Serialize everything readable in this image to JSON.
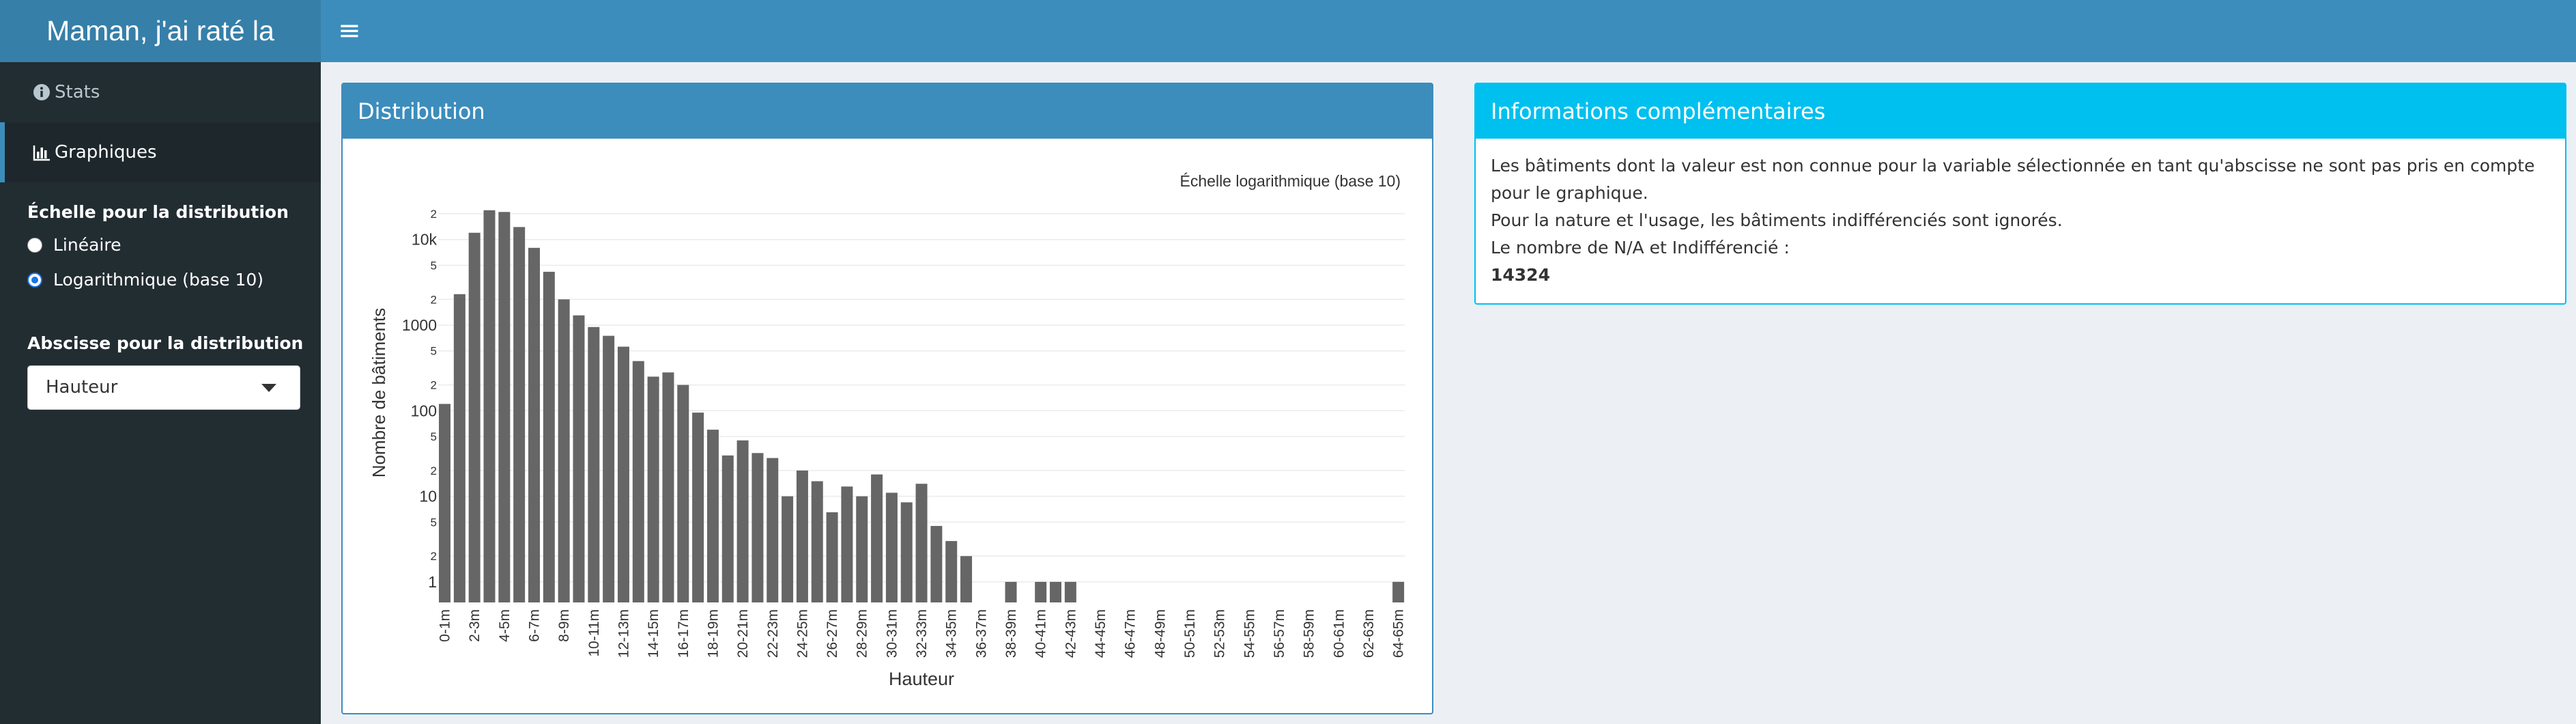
{
  "app": {
    "title": "Maman, j'ai raté la"
  },
  "header": {
    "menu_icon": "hamburger-icon"
  },
  "sidebar": {
    "items": [
      {
        "label": "Stats",
        "icon": "info-circle-icon"
      },
      {
        "label": "Graphiques",
        "icon": "bar-chart-icon"
      }
    ],
    "scale": {
      "label": "Échelle pour la distribution",
      "options": [
        "Linéaire",
        "Logarithmique (base 10)"
      ],
      "selected": "Logarithmique (base 10)"
    },
    "abscissa": {
      "label": "Abscisse pour la distribution",
      "value": "Hauteur"
    }
  },
  "distribution_box": {
    "title": "Distribution"
  },
  "info_box": {
    "title": "Informations complémentaires",
    "line1": "Les bâtiments dont la valeur est non connue pour la variable sélectionnée en tant qu'abscisse ne sont pas pris en compte pour le graphique.",
    "line2": "Pour la nature et l'usage, les bâtiments indifférenciés sont ignorés.",
    "line3": "Le nombre de N/A et Indifférencié :",
    "count": "14324"
  },
  "colors": {
    "header": "#3c8dbc",
    "logo": "#367fa9",
    "sidebar": "#222d32",
    "info_accent": "#00c0ef",
    "bar": "#666666"
  },
  "chart_data": {
    "type": "bar",
    "subtitle": "Échelle logarithmique (base 10)",
    "xlabel": "Hauteur",
    "ylabel": "Nombre de bâtiments",
    "yscale": "log10",
    "ylim": [
      0.5,
      25000
    ],
    "y_ticks_major": [
      "1",
      "10",
      "100",
      "1000",
      "10k"
    ],
    "y_ticks_minor": [
      "2",
      "5"
    ],
    "categories": [
      "0-1m",
      "1-2m",
      "2-3m",
      "3-4m",
      "4-5m",
      "5-6m",
      "6-7m",
      "7-8m",
      "8-9m",
      "9-10m",
      "10-11m",
      "11-12m",
      "12-13m",
      "13-14m",
      "14-15m",
      "15-16m",
      "16-17m",
      "17-18m",
      "18-19m",
      "19-20m",
      "20-21m",
      "21-22m",
      "22-23m",
      "23-24m",
      "24-25m",
      "25-26m",
      "26-27m",
      "27-28m",
      "28-29m",
      "29-30m",
      "30-31m",
      "31-32m",
      "32-33m",
      "33-34m",
      "34-35m",
      "35-36m",
      "36-37m",
      "37-38m",
      "38-39m",
      "39-40m",
      "40-41m",
      "41-42m",
      "42-43m",
      "43-44m",
      "44-45m",
      "45-46m",
      "46-47m",
      "47-48m",
      "48-49m",
      "49-50m",
      "50-51m",
      "51-52m",
      "52-53m",
      "53-54m",
      "54-55m",
      "55-56m",
      "56-57m",
      "57-58m",
      "58-59m",
      "59-60m",
      "60-61m",
      "61-62m",
      "62-63m",
      "63-64m",
      "64-65m"
    ],
    "x_tick_labels": [
      "0-1m",
      "2-3m",
      "4-5m",
      "6-7m",
      "8-9m",
      "10-11m",
      "12-13m",
      "14-15m",
      "16-17m",
      "18-19m",
      "20-21m",
      "22-23m",
      "24-25m",
      "26-27m",
      "28-29m",
      "30-31m",
      "32-33m",
      "34-35m",
      "36-37m",
      "38-39m",
      "40-41m",
      "42-43m",
      "44-45m",
      "46-47m",
      "48-49m",
      "50-51m",
      "52-53m",
      "54-55m",
      "56-57m",
      "58-59m",
      "60-61m",
      "62-63m",
      "64-65m"
    ],
    "values": [
      120,
      2300,
      12000,
      22000,
      21000,
      14000,
      8000,
      4200,
      2000,
      1300,
      950,
      750,
      560,
      380,
      250,
      280,
      200,
      95,
      60,
      30,
      45,
      32,
      28,
      10,
      20,
      15,
      6.5,
      13,
      10,
      18,
      11,
      8.5,
      14,
      4.5,
      3,
      2,
      0,
      0,
      1,
      0,
      1,
      1,
      1,
      0,
      0,
      0,
      0,
      0,
      0,
      0,
      0,
      0,
      0,
      0,
      0,
      0,
      0,
      0,
      0,
      0,
      0,
      0,
      0,
      0,
      1
    ]
  }
}
